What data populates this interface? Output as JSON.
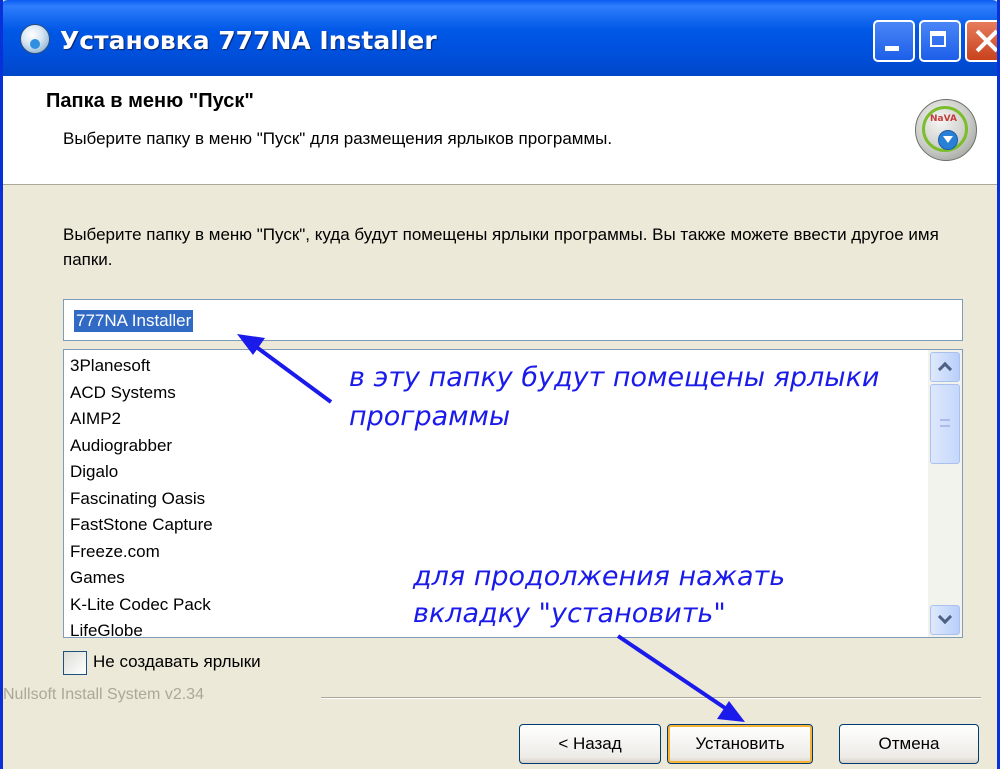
{
  "window": {
    "title": "Установка 777NA Installer"
  },
  "header": {
    "title": "Папка в меню \"Пуск\"",
    "subtitle": "Выберите папку в меню \"Пуск\" для размещения ярлыков программы.",
    "logo_icon": "installer-logo-icon"
  },
  "main": {
    "description": "Выберите папку в меню \"Пуск\", куда будут помещены ярлыки программы. Вы также можете ввести другое имя папки.",
    "folder_value": "777NA Installer",
    "folders": [
      "3Planesoft",
      "ACD Systems",
      "AIMP2",
      "Audiograbber",
      "Digalo",
      "Fascinating Oasis",
      "FastStone Capture",
      "Freeze.com",
      "Games",
      "K-Lite Codec Pack",
      "LifeGlobe"
    ],
    "no_shortcuts_label": "Не создавать ярлыки",
    "no_shortcuts_checked": false
  },
  "footer": {
    "branding": "Nullsoft Install System v2.34",
    "back_label": "< Назад",
    "install_label": "Установить",
    "cancel_label": "Отмена"
  },
  "annotations": {
    "folder_note_line1": "в эту папку будут помещены ярлыки",
    "folder_note_line2": "программы",
    "install_note_line1": "для продолжения нажать",
    "install_note_line2": "вкладку \"установить\""
  },
  "colors": {
    "annotation": "#1a1aeb",
    "titlebar": "#0054e3",
    "selection": "#316ac5"
  }
}
